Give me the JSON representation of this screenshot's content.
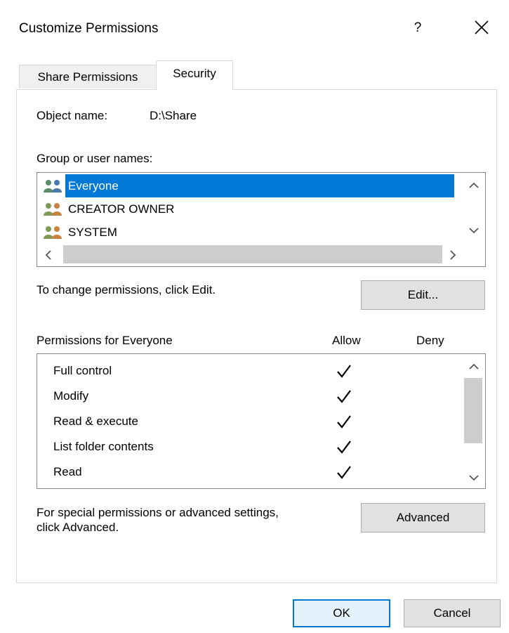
{
  "window": {
    "title": "Customize Permissions",
    "help": "?"
  },
  "tabs": [
    {
      "label": "Share Permissions",
      "active": false
    },
    {
      "label": "Security",
      "active": true
    }
  ],
  "object": {
    "label": "Object name:",
    "value": "D:\\Share"
  },
  "users": {
    "label": "Group or user names:",
    "items": [
      {
        "name": "Everyone",
        "selected": true
      },
      {
        "name": "CREATOR OWNER",
        "selected": false
      },
      {
        "name": "SYSTEM",
        "selected": false
      }
    ]
  },
  "edit": {
    "hint": "To change permissions, click Edit.",
    "button": "Edit..."
  },
  "permissions": {
    "header": "Permissions for Everyone",
    "allow_header": "Allow",
    "deny_header": "Deny",
    "items": [
      {
        "name": "Full control",
        "allow": true,
        "deny": false
      },
      {
        "name": "Modify",
        "allow": true,
        "deny": false
      },
      {
        "name": "Read & execute",
        "allow": true,
        "deny": false
      },
      {
        "name": "List folder contents",
        "allow": true,
        "deny": false
      },
      {
        "name": "Read",
        "allow": true,
        "deny": false
      }
    ]
  },
  "advanced": {
    "hint_line1": "For special permissions or advanced settings,",
    "hint_line2": "click Advanced.",
    "button": "Advanced"
  },
  "footer": {
    "ok": "OK",
    "cancel": "Cancel"
  },
  "colors": {
    "selection": "#0078d7",
    "button_face": "#e1e1e1",
    "default_border": "#0078d7"
  },
  "icons": {
    "user_group": "users-group-icon",
    "check": "check-icon"
  }
}
